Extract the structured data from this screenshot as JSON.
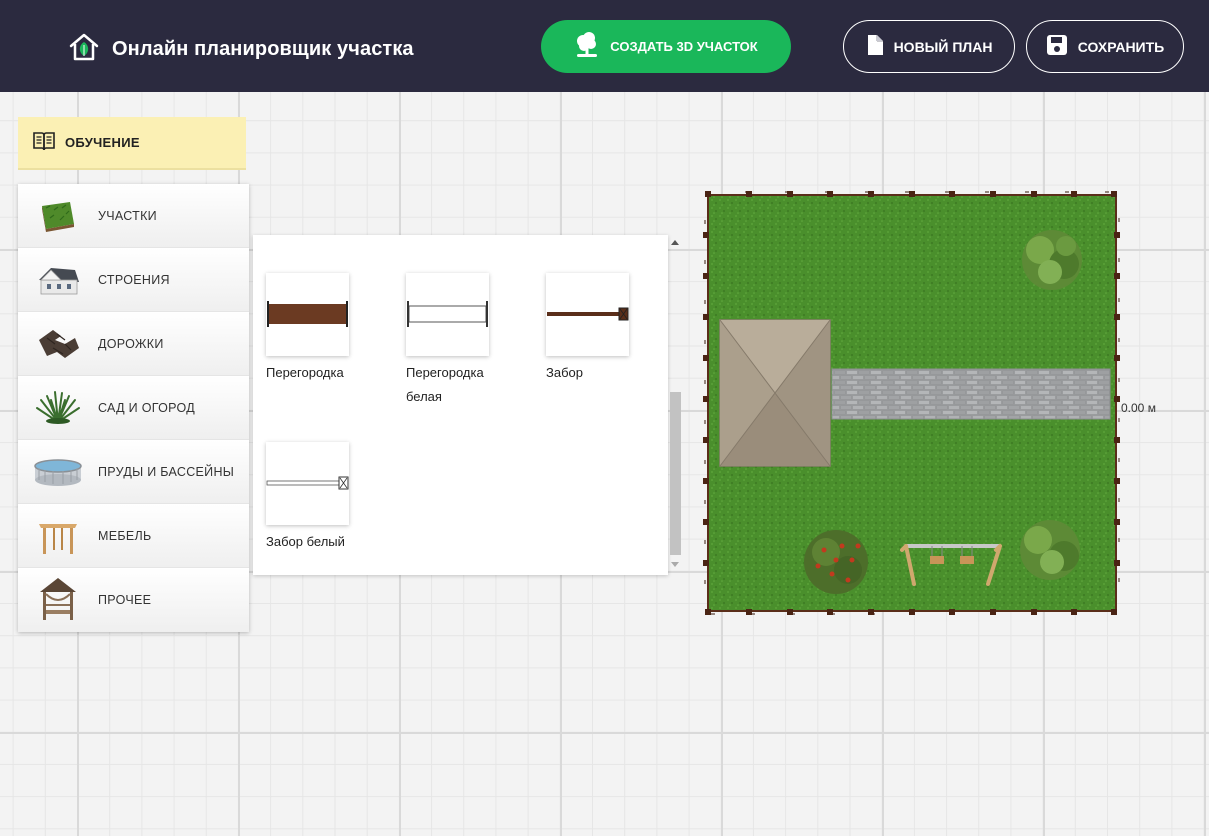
{
  "header": {
    "title": "Онлайн планировщик участка",
    "create_3d_label": "СОЗДАТЬ 3D УЧАСТОК",
    "new_plan_label": "НОВЫЙ ПЛАН",
    "save_label": "СОХРАНИТЬ"
  },
  "sidebar": {
    "tutorial_label": "ОБУЧЕНИЕ",
    "items": [
      {
        "label": "УЧАСТКИ",
        "icon": "grass-plot-icon"
      },
      {
        "label": "СТРОЕНИЯ",
        "icon": "house-icon"
      },
      {
        "label": "ДОРОЖКИ",
        "icon": "paving-tiles-icon"
      },
      {
        "label": "САД И ОГОРОД",
        "icon": "plant-icon"
      },
      {
        "label": "ПРУДЫ И БАССЕЙНЫ",
        "icon": "pool-icon"
      },
      {
        "label": "МЕБЕЛЬ",
        "icon": "table-icon"
      },
      {
        "label": "ПРОЧЕЕ",
        "icon": "gazebo-icon"
      }
    ]
  },
  "catalog": {
    "items": [
      {
        "label_1": "Перегородка",
        "label_2": ""
      },
      {
        "label_1": "Перегородка",
        "label_2": "белая"
      },
      {
        "label_1": "Забор",
        "label_2": ""
      },
      {
        "label_1": "Забор белый",
        "label_2": ""
      }
    ]
  },
  "plan": {
    "dimension_label": "0.00 м"
  },
  "colors": {
    "header_bg": "#2b2a3f",
    "accent_green": "#1ab75a",
    "tutorial_bg": "#fbf0b4",
    "lawn": "#4a8f2c",
    "fence": "#5a2e1a"
  }
}
